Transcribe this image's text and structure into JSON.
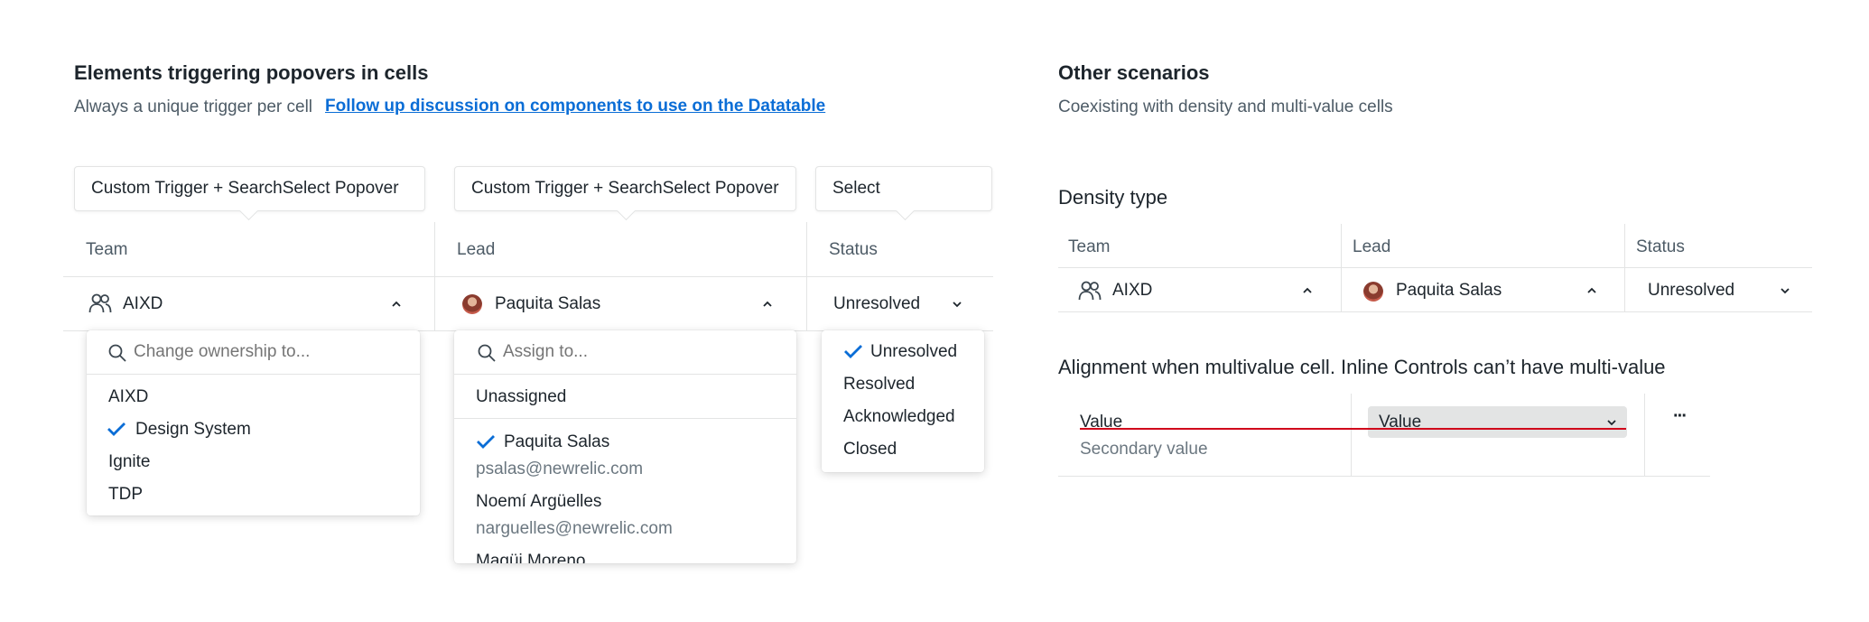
{
  "left": {
    "title": "Elements triggering popovers in cells",
    "subtitle": "Always a unique trigger per cell",
    "link": "Follow up discussion on components to use on the Datatable",
    "tooltips": [
      "Custom Trigger + SearchSelect Popover",
      "Custom Trigger + SearchSelect Popover",
      "Select"
    ],
    "columns": [
      "Team",
      "Lead",
      "Status"
    ],
    "row": {
      "team": "AIXD",
      "lead": "Paquita Salas",
      "status": "Unresolved"
    },
    "team_popover": {
      "placeholder": "Change ownership to...",
      "items": [
        "AIXD",
        "Design System",
        "Ignite",
        "TDP"
      ],
      "selected": "Design System"
    },
    "lead_popover": {
      "placeholder": "Assign to...",
      "unassigned": "Unassigned",
      "people": [
        {
          "name": "Paquita Salas",
          "email": "psalas@newrelic.com"
        },
        {
          "name": "Noemí Argüelles",
          "email": "narguelles@newrelic.com"
        },
        {
          "name": "Magüi Moreno"
        }
      ],
      "selected": "Paquita Salas"
    },
    "status_popover": {
      "items": [
        "Unresolved",
        "Resolved",
        "Acknowledged",
        "Closed"
      ],
      "selected": "Unresolved"
    }
  },
  "right": {
    "title": "Other scenarios",
    "subtitle": "Coexisting with density and multi-value cells",
    "density_title": "Density type",
    "columns": [
      "Team",
      "Lead",
      "Status"
    ],
    "row": {
      "team": "AIXD",
      "lead": "Paquita Salas",
      "status": "Unresolved"
    },
    "alignment_title": "Alignment when multivalue cell. Inline Controls can’t have multi-value",
    "multi": {
      "value": "Value",
      "secondary": "Secondary value",
      "select_value": "Value",
      "more": "···"
    }
  },
  "colors": {
    "accent": "#0a6dd6",
    "guide_line": "#d0021b",
    "select_bg": "#e3e4e4"
  }
}
